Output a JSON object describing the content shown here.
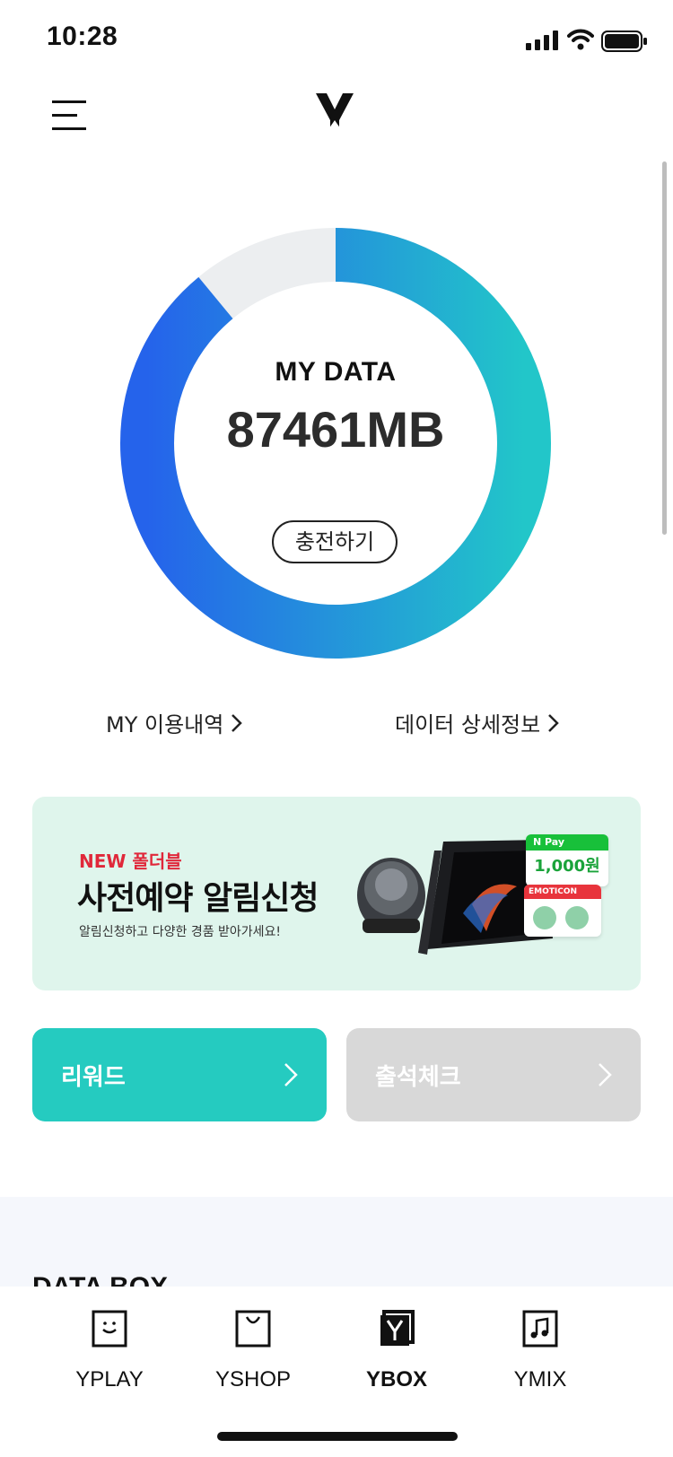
{
  "status_bar": {
    "time": "10:28"
  },
  "header": {
    "menu_icon": "hamburger-icon",
    "logo_icon": "y-logo-icon"
  },
  "data_widget": {
    "label": "MY DATA",
    "value": "87461MB",
    "charge_button": "충전하기",
    "remaining_fraction": 0.89,
    "colors": {
      "start": "#2563eb",
      "end": "#22c6c9",
      "track": "#eceef0"
    }
  },
  "links": {
    "usage": "MY 이용내역",
    "detail": "데이터 상세정보"
  },
  "banner": {
    "tag": "NEW 폴더블",
    "title": "사전예약 알림신청",
    "subtitle": "알림신청하고 다양한 경품 받아가세요!",
    "npay_label": "N Pay",
    "npay_amount": "1,000원",
    "emoticon_label": "EMOTICON"
  },
  "tiles": {
    "reward": "리워드",
    "attendance": "출석체크"
  },
  "section": {
    "data_box_title": "DATA BOX"
  },
  "bottom_nav": {
    "items": [
      {
        "label": "YPLAY",
        "icon": "smile-box-icon"
      },
      {
        "label": "YSHOP",
        "icon": "shopping-bag-icon"
      },
      {
        "label": "YBOX",
        "icon": "y-box-icon",
        "active": true
      },
      {
        "label": "YMIX",
        "icon": "music-note-icon"
      }
    ]
  }
}
